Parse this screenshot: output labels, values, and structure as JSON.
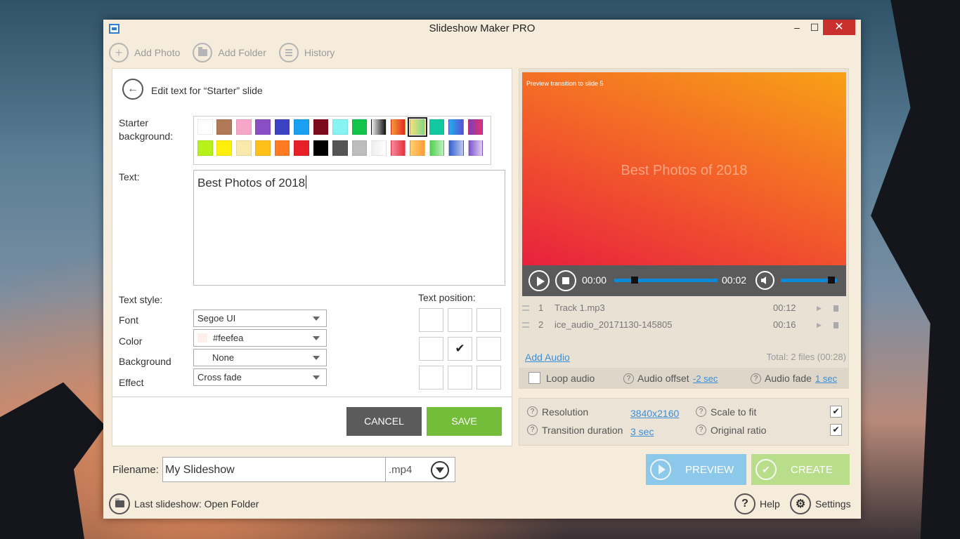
{
  "window": {
    "title": "Slideshow Maker PRO",
    "minimize": "–",
    "maximize": "☐",
    "close": "✕"
  },
  "toolbar": {
    "add_photo": "Add Photo",
    "add_folder": "Add Folder",
    "history": "History"
  },
  "editor": {
    "title": "Edit text for “Starter” slide",
    "background_label_1": "Starter",
    "background_label_2": "background:",
    "swatch_row_1": [
      "#ffffff",
      "#b07a58",
      "#f6a6c8",
      "#8a4fc4",
      "#3b43c4",
      "#1aa0f0",
      "#7d0a1e",
      "#86f4f2",
      "#12c44a",
      "linear-gradient(90deg,#eee,#111)",
      "linear-gradient(90deg,#f0a030,#e82828)",
      "linear-gradient(90deg,#f5e07a,#7ed98a)",
      "#12c8a0",
      "linear-gradient(90deg,#1fb0e8,#5a50d8)",
      "linear-gradient(90deg,#7840c0,#e8306a)"
    ],
    "swatch_row_2": [
      "#b6f21a",
      "#ffef0a",
      "#f9e9aa",
      "#ffc01a",
      "#ff7a20",
      "#e82028",
      "#000000",
      "#555555",
      "#bdbdbd",
      "linear-gradient(90deg,#eee,#fff)",
      "linear-gradient(90deg,#f58aa0,#e8303a)",
      "linear-gradient(90deg,#ffd06a,#ff9a3a)",
      "linear-gradient(90deg,#50d050,#c0f0c0)",
      "linear-gradient(90deg,#3060d0,#c0c8f0)",
      "linear-gradient(90deg,#7a50d0,#e0d0f0)"
    ],
    "selected_swatch": "row1-11",
    "text_label": "Text:",
    "text_value": "Best Photos of 2018",
    "text_style_label": "Text style:",
    "font_label": "Font",
    "font_value": "Segoe UI",
    "color_label": "Color",
    "color_value": "#feefea",
    "background_label": "Background",
    "background_value": "None",
    "effect_label": "Effect",
    "effect_value": "Cross fade",
    "text_position_label": "Text position:",
    "position_check": "✔",
    "selected_position": "middle-center",
    "cancel": "CANCEL",
    "save": "SAVE"
  },
  "preview": {
    "label": "Preview transition to slide 5",
    "slide_text": "Best Photos of 2018",
    "time_current": "00:00",
    "time_total": "00:02",
    "progress_fraction": 0.2,
    "volume_fraction": 0.9
  },
  "audio": {
    "tracks": [
      {
        "num": "1",
        "name": "Track 1.mp3",
        "duration": "00:12"
      },
      {
        "num": "2",
        "name": "ice_audio_20171130-145805",
        "duration": "00:16"
      }
    ],
    "add_audio": "Add Audio",
    "total": "Total: 2 files (00:28)",
    "loop_audio": "Loop audio",
    "offset_label": "Audio offset",
    "offset_value": "-2 sec",
    "fade_label": "Audio fade",
    "fade_value": "1 sec",
    "help_glyph": "?"
  },
  "settings": {
    "resolution_label": "Resolution",
    "resolution_value": "3840x2160",
    "transition_label": "Transition duration",
    "transition_value": "3 sec",
    "scale_label": "Scale to fit",
    "ratio_label": "Original ratio",
    "check_glyph": "✔"
  },
  "bottom": {
    "filename_label": "Filename:",
    "filename_value": "My Slideshow",
    "extension": ".mp4",
    "preview_button": "PREVIEW",
    "create_button": "CREATE",
    "last_slideshow": "Last slideshow: Open Folder",
    "help": "Help",
    "settings": "Settings"
  },
  "colors": {
    "save": "#74bd3a",
    "cancel": "#5b5b5b",
    "preview_btn": "#8bc8ea",
    "create_btn": "#b8de8c",
    "link": "#3b8ed8",
    "progress": "#0a8ad8"
  }
}
